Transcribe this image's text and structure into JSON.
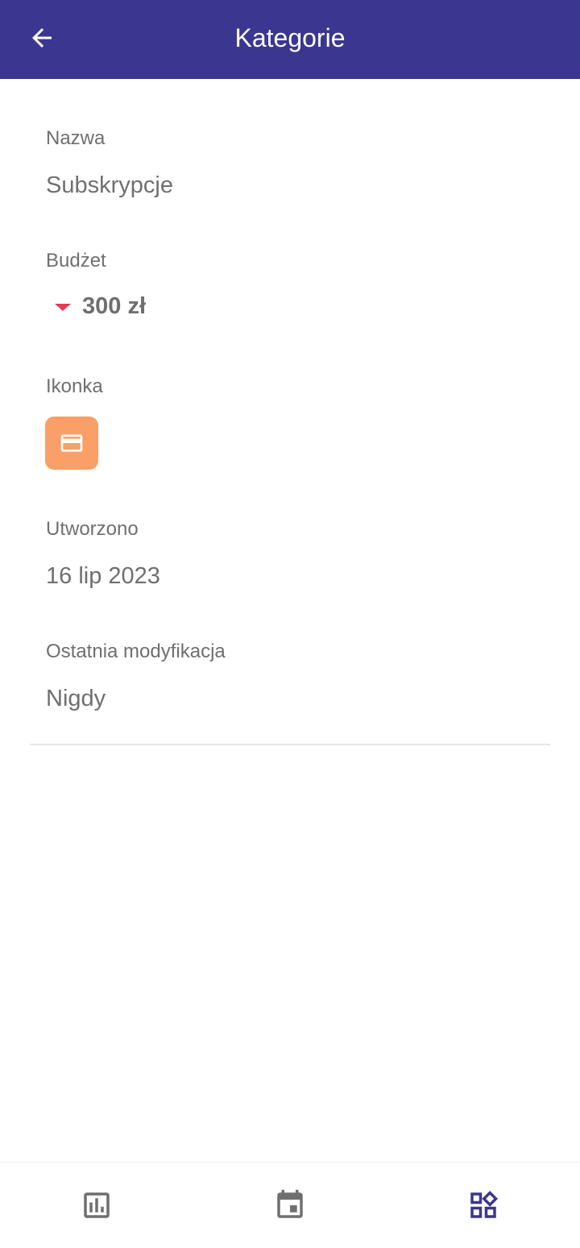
{
  "header": {
    "title": "Kategorie",
    "back_icon": "arrow-back-icon"
  },
  "fields": {
    "name": {
      "label": "Nazwa",
      "value": "Subskrypcje"
    },
    "budget": {
      "label": "Budżet",
      "value": "300 zł",
      "trend_icon": "triangle-down-icon",
      "trend_color": "#e53950"
    },
    "icon": {
      "label": "Ikonka",
      "icon": "credit-card-icon",
      "color": "#f99f67"
    },
    "created": {
      "label": "Utworzono",
      "value": "16 lip 2023"
    },
    "modified": {
      "label": "Ostatnia modyfikacja",
      "value": "Nigdy"
    }
  },
  "bottom_nav": {
    "items": [
      {
        "icon": "bar-chart-icon",
        "active": false
      },
      {
        "icon": "calendar-event-icon",
        "active": false
      },
      {
        "icon": "categories-icon",
        "active": true
      }
    ],
    "active_color": "#3b368f",
    "inactive_color": "#6f6f6f"
  },
  "colors": {
    "primary": "#3b368f",
    "text_secondary": "#6f6f6f"
  }
}
